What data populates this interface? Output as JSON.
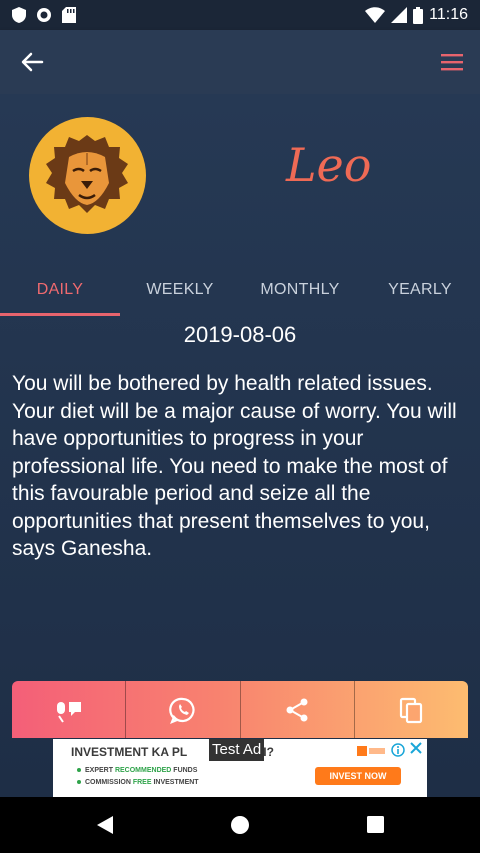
{
  "status_bar": {
    "time": "11:16",
    "icons": [
      "shield-icon",
      "circle-status-icon",
      "sd-card-icon",
      "wifi-icon",
      "signal-icon",
      "battery-icon"
    ]
  },
  "app_bar": {
    "back_icon": "arrow-left-icon",
    "menu_icon": "hamburger-menu-icon",
    "menu_color": "#e8646d"
  },
  "sign": {
    "name": "Leo",
    "avatar_icon": "lion-icon"
  },
  "tabs": [
    {
      "label": "DAILY",
      "active": true
    },
    {
      "label": "WEEKLY",
      "active": false
    },
    {
      "label": "MONTHLY",
      "active": false
    },
    {
      "label": "YEARLY",
      "active": false
    }
  ],
  "horoscope": {
    "date": "2019-08-06",
    "text": "You will be bothered by health related issues. Your diet will be a major cause of worry. You will have opportunities to progress in your professional life. You need to make the most of this favourable period and seize all the opportunities that present themselves to you, says Ganesha."
  },
  "actions": [
    {
      "icon": "speak-icon"
    },
    {
      "icon": "whatsapp-icon"
    },
    {
      "icon": "share-icon"
    },
    {
      "icon": "copy-icon"
    }
  ],
  "ad": {
    "badge": "Test Ad",
    "headline_part1": "INVESTMENT KA PL",
    "headline_part2": "AI?",
    "line1_a": "EXPERT ",
    "line1_b": "RECOMMENDED",
    "line1_c": " FUNDS",
    "line2_a": "COMMISSION ",
    "line2_b": "FREE",
    "line2_c": " INVESTMENT",
    "cta": "INVEST NOW"
  },
  "colors": {
    "accent": "#e8646d",
    "title_color": "#ef6a55",
    "avatar_bg": "#f2b233",
    "action_gradient_start": "#f45f78",
    "action_gradient_end": "#fdbc70"
  },
  "nav_bar": {
    "buttons": [
      "back-triangle-icon",
      "home-circle-icon",
      "recents-square-icon"
    ]
  }
}
